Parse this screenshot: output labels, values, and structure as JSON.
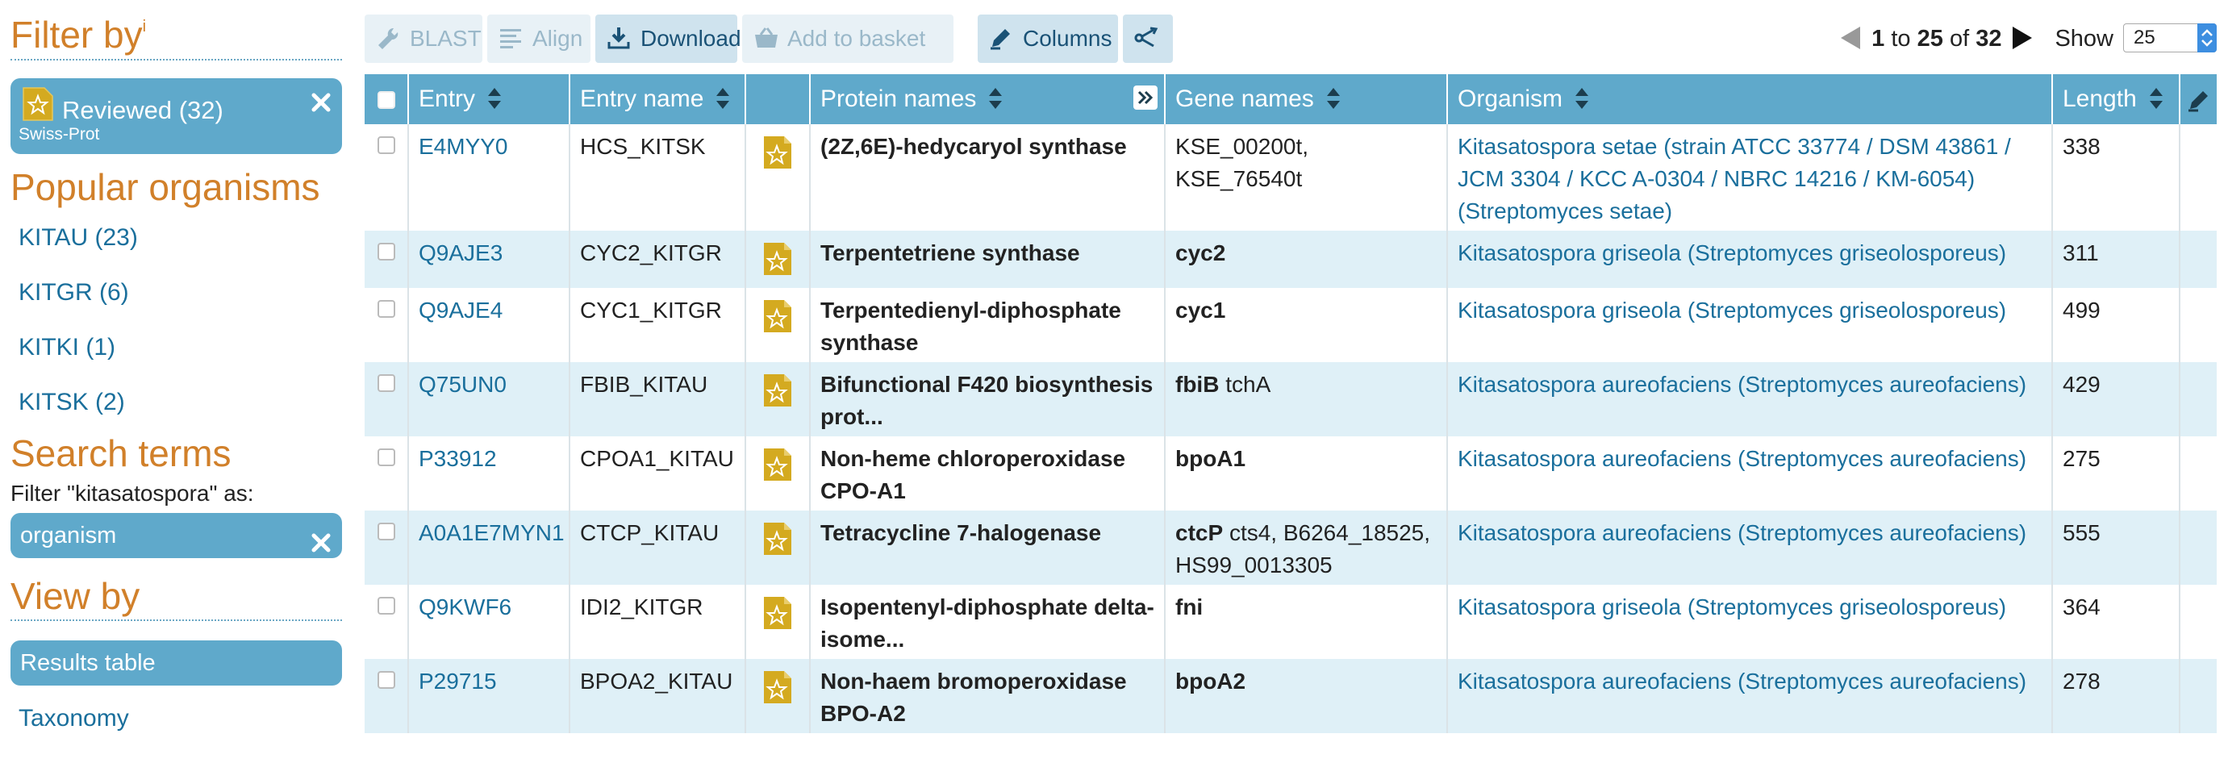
{
  "sidebar": {
    "filter_title": "Filter by",
    "filter_sup": "i",
    "reviewed_label": "Reviewed (32)",
    "reviewed_sub": "Swiss-Prot",
    "popular_title": "Popular organisms",
    "organisms": [
      "KITAU (23)",
      "KITGR (6)",
      "KITKI (1)",
      "KITSK (2)"
    ],
    "search_title": "Search terms",
    "search_filter_text": "Filter \"kitasatospora\" as:",
    "search_filter_value": "organism",
    "view_title": "View by",
    "view_active": "Results table",
    "view_link": "Taxonomy"
  },
  "toolbar": {
    "blast": "BLAST",
    "align": "Align",
    "download": "Download",
    "add_to_basket": "Add to basket",
    "columns": "Columns"
  },
  "pager": {
    "from": "1",
    "to_word": "to",
    "to": "25",
    "of_word": "of",
    "total": "32",
    "show_label": "Show",
    "show_value": "25"
  },
  "table": {
    "headers": {
      "entry": "Entry",
      "entry_name": "Entry name",
      "protein_names": "Protein names",
      "gene_names": "Gene names",
      "organism": "Organism",
      "length": "Length"
    },
    "rows": [
      {
        "entry": "E4MYY0",
        "entry_name": "HCS_KITSK",
        "protein": "(2Z,6E)-hedycaryol synthase",
        "gene_primary": "",
        "gene_other": "KSE_00200t, KSE_76540t",
        "organism": "Kitasatospora setae (strain ATCC 33774 / DSM 43861 / JCM 3304 / KCC A-0304 / NBRC 14216 / KM-6054) (Streptomyces setae)",
        "length": "338"
      },
      {
        "entry": "Q9AJE3",
        "entry_name": "CYC2_KITGR",
        "protein": "Terpentetriene synthase",
        "gene_primary": "cyc2",
        "gene_other": "",
        "organism": "Kitasatospora griseola (Streptomyces griseolosporeus)",
        "length": "311"
      },
      {
        "entry": "Q9AJE4",
        "entry_name": "CYC1_KITGR",
        "protein": "Terpentedienyl-diphosphate synthase",
        "gene_primary": "cyc1",
        "gene_other": "",
        "organism": "Kitasatospora griseola (Streptomyces griseolosporeus)",
        "length": "499"
      },
      {
        "entry": "Q75UN0",
        "entry_name": "FBIB_KITAU",
        "protein": "Bifunctional F420 biosynthesis prot...",
        "gene_primary": "fbiB",
        "gene_other": "tchA",
        "organism": "Kitasatospora aureofaciens (Streptomyces aureofaciens)",
        "length": "429"
      },
      {
        "entry": "P33912",
        "entry_name": "CPOA1_KITAU",
        "protein": "Non-heme chloroperoxidase CPO-A1",
        "gene_primary": "bpoA1",
        "gene_other": "",
        "organism": "Kitasatospora aureofaciens (Streptomyces aureofaciens)",
        "length": "275"
      },
      {
        "entry": "A0A1E7MYN1",
        "entry_name": "CTCP_KITAU",
        "protein": "Tetracycline 7-halogenase",
        "gene_primary": "ctcP",
        "gene_other": "cts4, B6264_18525, HS99_0013305",
        "organism": "Kitasatospora aureofaciens (Streptomyces aureofaciens)",
        "length": "555"
      },
      {
        "entry": "Q9KWF6",
        "entry_name": "IDI2_KITGR",
        "protein": "Isopentenyl-diphosphate delta-isome...",
        "gene_primary": "fni",
        "gene_other": "",
        "organism": "Kitasatospora griseola (Streptomyces griseolosporeus)",
        "length": "364"
      },
      {
        "entry": "P29715",
        "entry_name": "BPOA2_KITAU",
        "protein": "Non-haem bromoperoxidase BPO-A2",
        "gene_primary": "bpoA2",
        "gene_other": "",
        "organism": "Kitasatospora aureofaciens (Streptomyces aureofaciens)",
        "length": "278"
      }
    ]
  },
  "icons": {
    "reviewed": "reviewed-star-document-icon",
    "close": "close-x-icon",
    "sort": "sort-arrows-icon",
    "edit": "pencil-icon",
    "share": "share-icon"
  },
  "colors": {
    "accent": "#5fa9cb",
    "link": "#1a6f9c",
    "section_title": "#d1802a",
    "row_alt": "#dff0f7",
    "reviewed_icon": "#d4aa20"
  }
}
